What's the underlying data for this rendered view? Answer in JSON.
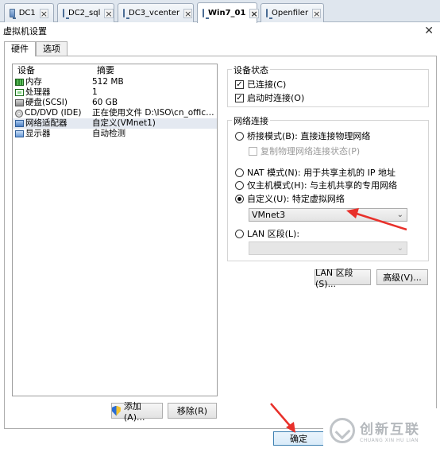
{
  "vm_tabs": [
    {
      "label": "DC1"
    },
    {
      "label": "DC2_sql"
    },
    {
      "label": "DC3_vcenter"
    },
    {
      "label": "Win7_01"
    },
    {
      "label": "Openfiler"
    }
  ],
  "dialog": {
    "title": "虚拟机设置",
    "tabs": [
      "硬件",
      "选项"
    ]
  },
  "devices": {
    "headers": [
      "设备",
      "摘要"
    ],
    "rows": [
      {
        "icon": "memory-icon",
        "name": "内存",
        "summary": "512 MB"
      },
      {
        "icon": "processor-icon",
        "name": "处理器",
        "summary": "1"
      },
      {
        "icon": "harddisk-icon",
        "name": "硬盘(SCSI)",
        "summary": "60 GB"
      },
      {
        "icon": "cdrom-icon",
        "name": "CD/DVD (IDE)",
        "summary": "正在使用文件 D:\\ISO\\cn_office_p..."
      },
      {
        "icon": "network-adapter-icon",
        "name": "网络适配器",
        "summary": "自定义(VMnet1)"
      },
      {
        "icon": "display-icon",
        "name": "显示器",
        "summary": "自动检测"
      }
    ],
    "add_label": "添加(A)...",
    "remove_label": "移除(R)"
  },
  "device_status": {
    "label": "设备状态",
    "connected": "已连接(C)",
    "connect_on_power": "启动时连接(O)"
  },
  "network": {
    "label": "网络连接",
    "bridged": "桥接模式(B): 直接连接物理网络",
    "replicate": "复制物理网络连接状态(P)",
    "nat": "NAT 模式(N): 用于共享主机的 IP 地址",
    "host_only": "仅主机模式(H): 与主机共享的专用网络",
    "custom": "自定义(U): 特定虚拟网络",
    "custom_value": "VMnet3",
    "lan": "LAN 区段(L):",
    "lan_segments_button": "LAN 区段(S)...",
    "advanced_button": "高级(V)..."
  },
  "ok_button": "确定",
  "watermark": {
    "cn": "创新互联",
    "en": "CHUANG XIN HU LIAN"
  },
  "colors": {
    "annotation_arrow": "#e8302a"
  }
}
